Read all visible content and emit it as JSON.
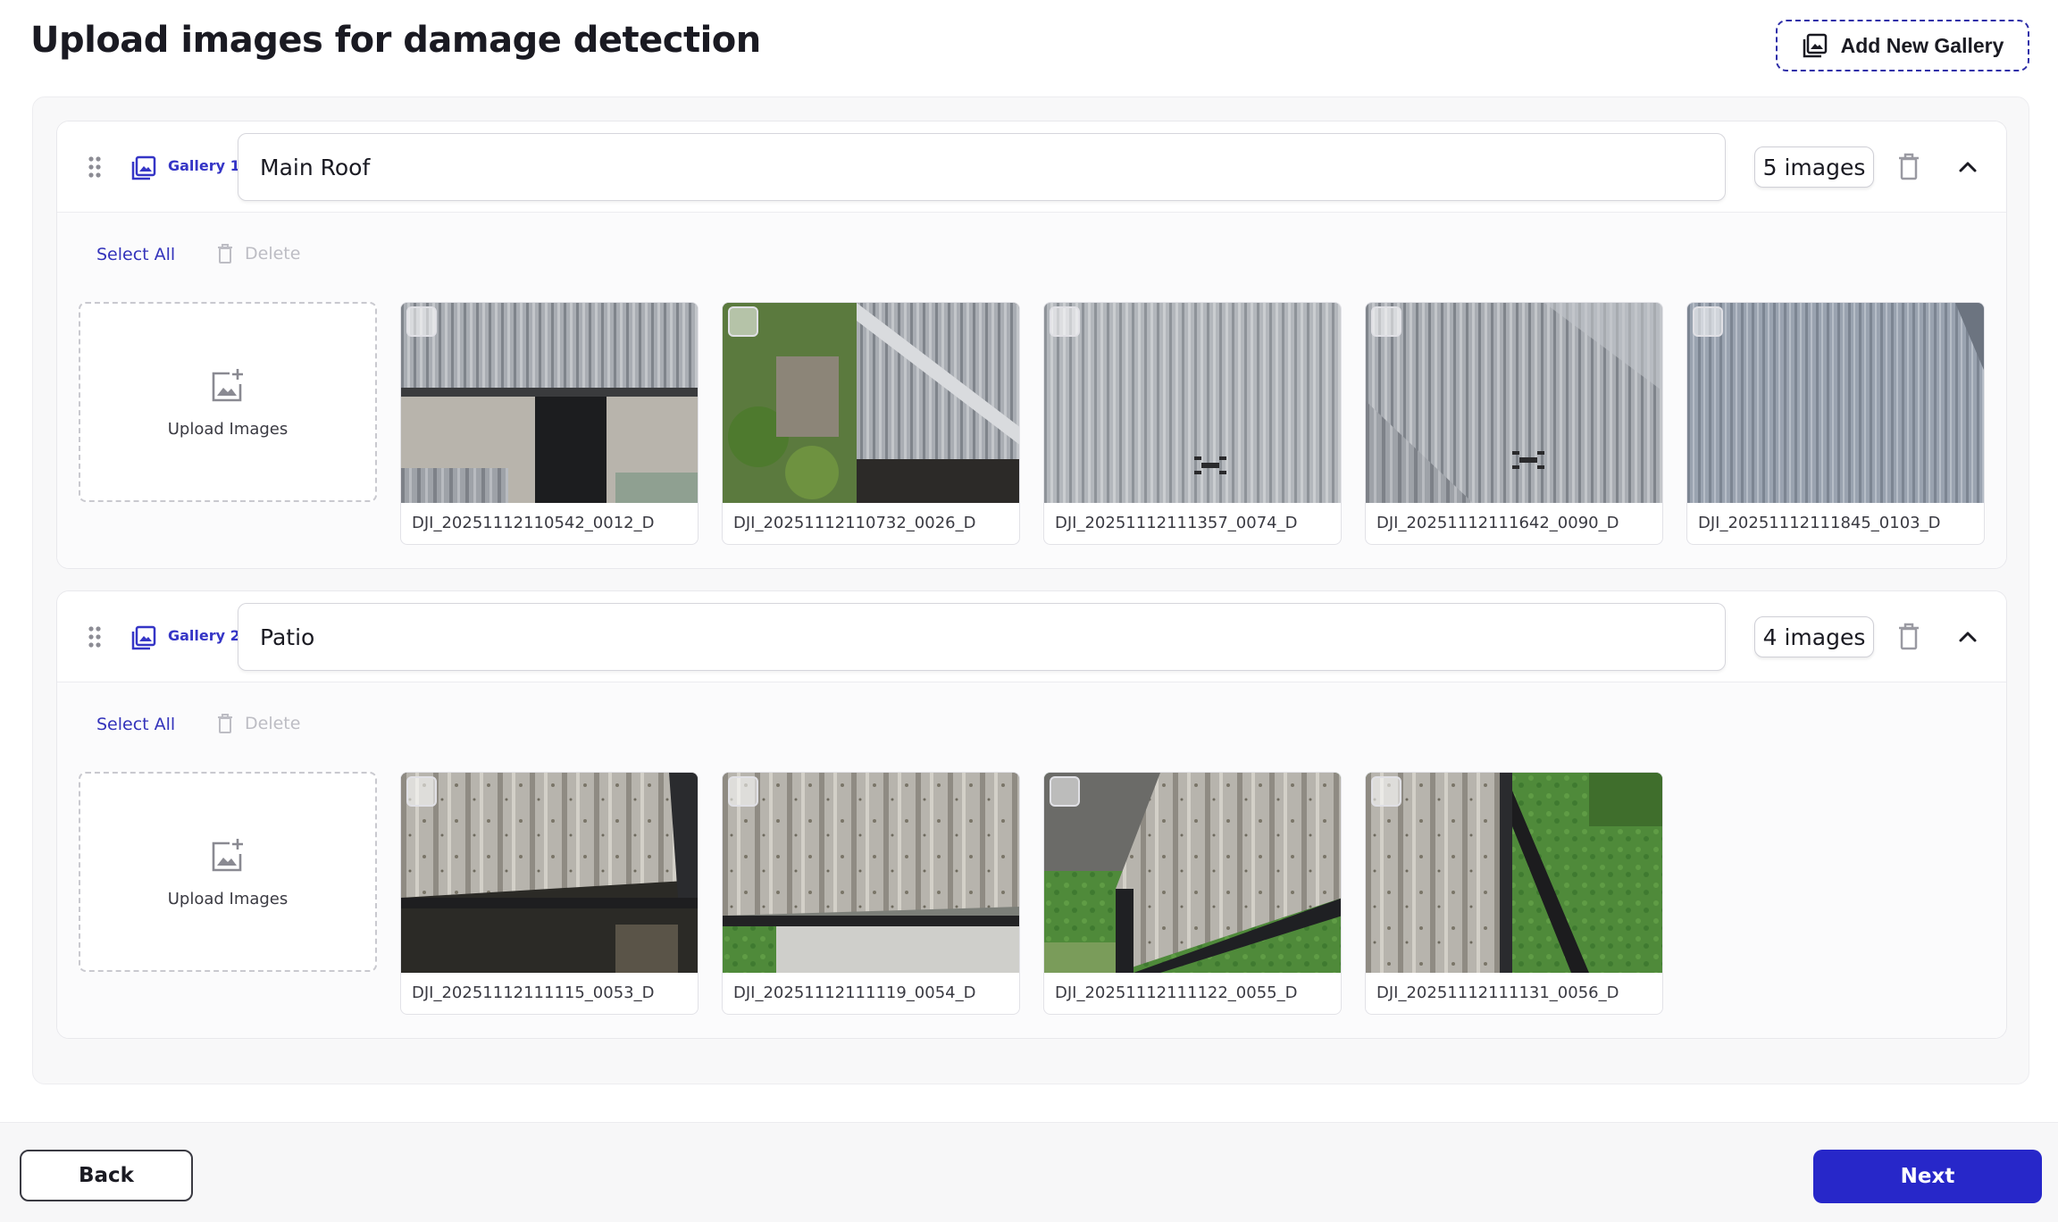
{
  "header": {
    "title": "Upload images for damage detection",
    "add_gallery_label": "Add New Gallery"
  },
  "galleries": [
    {
      "label": "Gallery 1",
      "name": "Main Roof",
      "count": "5 images",
      "select_all": "Select All",
      "delete": "Delete",
      "upload_label": "Upload Images",
      "images": [
        "DJI_20251112110542_0012_D",
        "DJI_20251112110732_0026_D",
        "DJI_20251112111357_0074_D",
        "DJI_20251112111642_0090_D",
        "DJI_20251112111845_0103_D"
      ]
    },
    {
      "label": "Gallery 2",
      "name": "Patio",
      "count": "4 images",
      "select_all": "Select All",
      "delete": "Delete",
      "upload_label": "Upload Images",
      "images": [
        "DJI_20251112111115_0053_D",
        "DJI_20251112111119_0054_D",
        "DJI_20251112111122_0055_D",
        "DJI_20251112111131_0056_D"
      ]
    }
  ],
  "footer": {
    "back_label": "Back",
    "next_label": "Next"
  },
  "colors": {
    "accent": "#2727c9",
    "accent_text": "#3535c6",
    "disabled": "#bdbdc4"
  },
  "icons": {
    "gallery": "gallery-icon",
    "drag": "drag-handle-icon",
    "trash": "trash-icon",
    "collapse": "chevron-up-icon",
    "upload": "image-add-icon"
  }
}
